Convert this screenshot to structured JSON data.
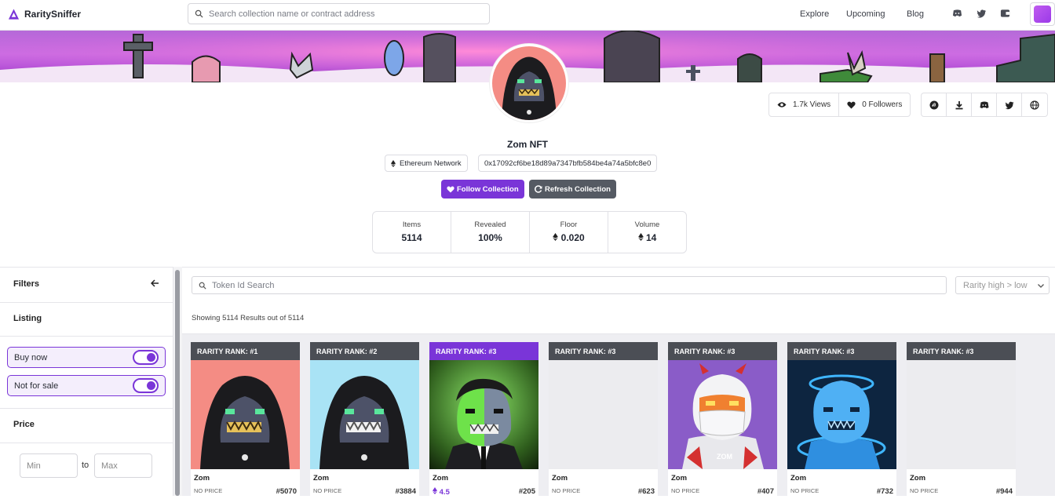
{
  "nav": {
    "brand": "RaritySniffer",
    "search_placeholder": "Search collection name or contract address",
    "links": [
      "Explore",
      "Upcoming",
      "Blog"
    ],
    "icons": [
      "discord-icon",
      "twitter-icon",
      "wallet-icon"
    ]
  },
  "collection": {
    "name": "Zom NFT",
    "network": "Ethereum Network",
    "contract": "0x17092cf6be18d89a7347bfb584be4a74a5bfc8e0",
    "views": "1.7k Views",
    "followers": "0 Followers",
    "follow_label": "Follow Collection",
    "refresh_label": "Refresh Collection",
    "socials": [
      "opensea-icon",
      "looksrare-icon",
      "discord-icon",
      "twitter-icon",
      "website-icon"
    ]
  },
  "metrics": [
    {
      "label": "Items",
      "value": "5114"
    },
    {
      "label": "Revealed",
      "value": "100%"
    },
    {
      "label": "Floor",
      "value": "0.020"
    },
    {
      "label": "Volume",
      "value": "14"
    }
  ],
  "sidebar": {
    "filters": "Filters",
    "listing": "Listing",
    "buy_now": "Buy now",
    "not_for_sale": "Not for sale",
    "price": "Price",
    "min_placeholder": "Min",
    "to": "to",
    "max_placeholder": "Max"
  },
  "main": {
    "token_search_placeholder": "Token Id Search",
    "sort": "Rarity high > low",
    "results": "Showing 5114 Results out of 5114"
  },
  "cards": [
    {
      "rank": "RARITY RANK: #1",
      "name": "Zom",
      "price": "NO PRICE",
      "id": "#5070",
      "bg": "#f48c84",
      "style": "hood"
    },
    {
      "rank": "RARITY RANK: #2",
      "name": "Zom",
      "price": "NO PRICE",
      "id": "#3884",
      "bg": "#a9e3f5",
      "style": "hood"
    },
    {
      "rank": "RARITY RANK: #3",
      "name": "Zom",
      "price": "4.5",
      "id": "#205",
      "bg": "#2f5e1d",
      "style": "suit",
      "listed": true
    },
    {
      "rank": "RARITY RANK: #3",
      "name": "Zom",
      "price": "NO PRICE",
      "id": "#623",
      "bg": "#ececef",
      "style": "blank"
    },
    {
      "rank": "RARITY RANK: #3",
      "name": "Zom",
      "price": "NO PRICE",
      "id": "#407",
      "bg": "#8a5cc8",
      "style": "white"
    },
    {
      "rank": "RARITY RANK: #3",
      "name": "Zom",
      "price": "NO PRICE",
      "id": "#732",
      "bg": "#0d2540",
      "style": "ice"
    },
    {
      "rank": "RARITY RANK: #3",
      "name": "Zom",
      "price": "NO PRICE",
      "id": "#944",
      "bg": "#ececef",
      "style": "blank"
    }
  ],
  "colors": {
    "accent": "#7a35d8",
    "header": "#4b4e55"
  }
}
